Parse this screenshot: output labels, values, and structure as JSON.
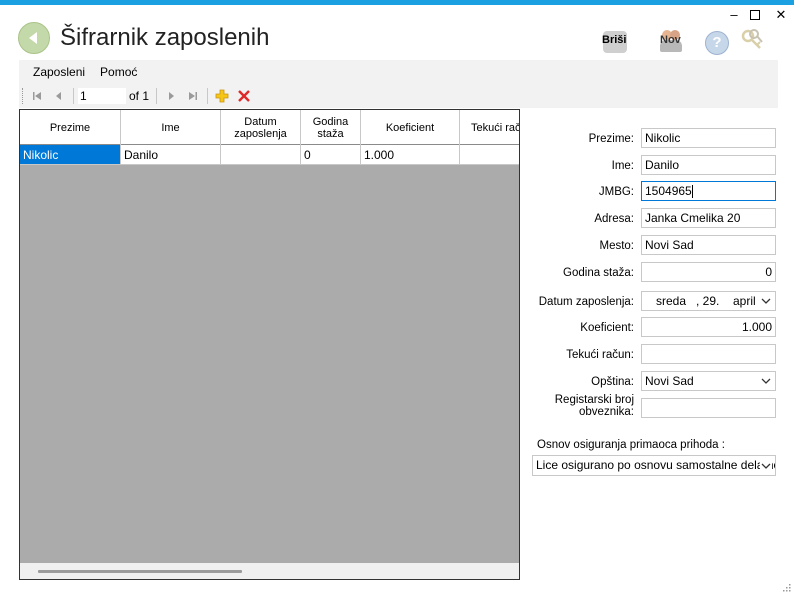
{
  "window": {
    "minimize": "–",
    "close": "✕"
  },
  "title": "Šifrarnik zaposlenih",
  "toolbar_icons": {
    "brisi": "Briši",
    "nov": "Nov",
    "help": "?"
  },
  "menu": {
    "items": [
      "Zaposleni",
      "Pomoć"
    ]
  },
  "navigator": {
    "position": "1",
    "of_label": "of 1"
  },
  "grid": {
    "columns": [
      "Prezime",
      "Ime",
      "Datum zaposlenja",
      "Godina staža",
      "Koeficient",
      "Tekući račun"
    ],
    "rows": [
      [
        "Nikolic",
        "Danilo",
        "",
        "0",
        "1.000",
        ""
      ]
    ]
  },
  "form": {
    "prezime": {
      "label": "Prezime:",
      "value": "Nikolic"
    },
    "ime": {
      "label": "Ime:",
      "value": "Danilo"
    },
    "jmbg": {
      "label": "JMBG:",
      "value": "1504965"
    },
    "adresa": {
      "label": "Adresa:",
      "value": "Janka Cmelika 20"
    },
    "mesto": {
      "label": "Mesto:",
      "value": "Novi Sad"
    },
    "godina_staza": {
      "label": "Godina staža:",
      "value": "0"
    },
    "datum_zaposlenja": {
      "label": "Datum zaposlenja:",
      "day": "sreda",
      "date": ", 29.",
      "month": "april"
    },
    "koeficient": {
      "label": "Koeficient:",
      "value": "1.000"
    },
    "tekuci_racun": {
      "label": "Tekući račun:",
      "value": ""
    },
    "opstina": {
      "label": "Opština:",
      "value": "Novi Sad"
    },
    "registarski_broj": {
      "label_line1": "Registarski broj",
      "label_line2": "obveznika:",
      "value": ""
    }
  },
  "osnov": {
    "label": "Osnov osiguranja primaoca prihoda :",
    "value": "Lice osigurano po osnovu samostalne delatnost"
  },
  "colors": {
    "accent_bar": "#1ba1e2",
    "selection": "#0078d7"
  }
}
